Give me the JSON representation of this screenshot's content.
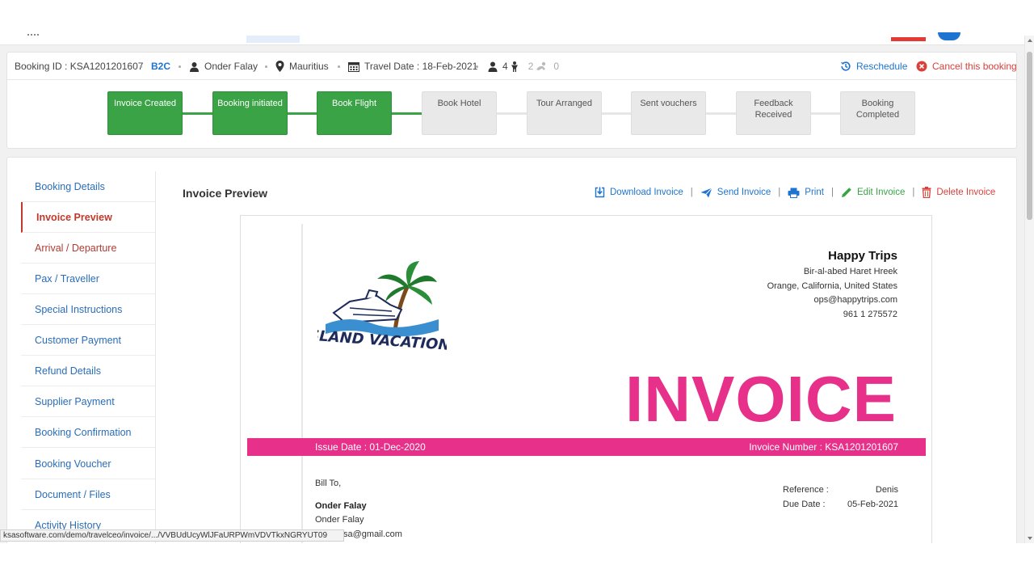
{
  "infobar": {
    "booking_id": "Booking ID : KSA1201201607",
    "channel": "B2C",
    "customer": "Onder Falay",
    "destination": "Mauritius",
    "travel_date": "Travel Date : 18-Feb-2021",
    "adults": "4",
    "children": "2",
    "infants": "0",
    "reschedule_label": "Reschedule",
    "cancel_label": "Cancel this booking"
  },
  "steps": [
    {
      "label": "Invoice Created",
      "status": "done"
    },
    {
      "label": "Booking initiated",
      "status": "done"
    },
    {
      "label": "Book Flight",
      "status": "done"
    },
    {
      "label": "Book Hotel",
      "status": "pending"
    },
    {
      "label": "Tour Arranged",
      "status": "pending"
    },
    {
      "label": "Sent vouchers",
      "status": "pending"
    },
    {
      "label": "Feedback Received",
      "status": "pending"
    },
    {
      "label": "Booking Completed",
      "status": "pending"
    }
  ],
  "sidebar": {
    "items": [
      {
        "label": "Booking Details"
      },
      {
        "label": "Invoice Preview"
      },
      {
        "label": "Arrival / Departure"
      },
      {
        "label": "Pax / Traveller"
      },
      {
        "label": "Special Instructions"
      },
      {
        "label": "Customer Payment"
      },
      {
        "label": "Refund Details"
      },
      {
        "label": "Supplier Payment"
      },
      {
        "label": "Booking Confirmation"
      },
      {
        "label": "Booking Voucher"
      },
      {
        "label": "Document / Files"
      },
      {
        "label": "Activity History"
      }
    ],
    "active_index": 1
  },
  "preview": {
    "title": "Invoice Preview",
    "actions": {
      "download": "Download Invoice",
      "send": "Send Invoice",
      "print": "Print",
      "edit": "Edit Invoice",
      "delete": "Delete Invoice"
    }
  },
  "invoice": {
    "logo_text": "ISLAND VACATIONS",
    "company_name": "Happy Trips",
    "address_line1": "Bir-al-abed Haret Hreek",
    "address_line2": "Orange, California, United States",
    "email": "ops@happytrips.com",
    "phone": "961 1 275572",
    "heading": "INVOICE",
    "issue_date": "Issue Date : 01-Dec-2020",
    "invoice_number": "Invoice Number : KSA1201201607",
    "bill_to_label": "Bill To,",
    "bill_name": "Onder Falay",
    "bill_line": "Onder Falay",
    "bill_email": "sa@gmail.com",
    "reference_label": "Reference :",
    "reference_value": "Denis",
    "due_date_label": "Due Date :",
    "due_date_value": "05-Feb-2021"
  },
  "statusbar": {
    "url": "ksasoftware.com/demo/travelceo/invoice/.../VVBUdUcyWlJFaURPWmVDVTkxNGRYUT09"
  },
  "colors": {
    "accent_blue": "#1e74d0",
    "step_done": "#3aa346",
    "invoice_pink": "#e6308a",
    "danger_red": "#d9403a"
  }
}
